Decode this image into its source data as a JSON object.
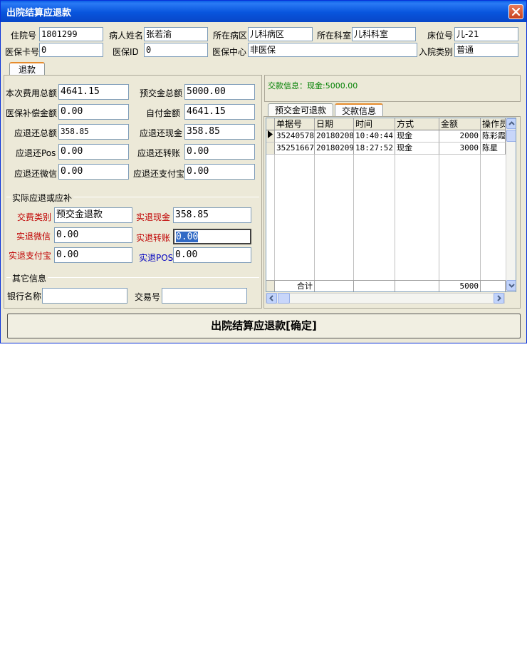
{
  "window": {
    "title": "出院结算应退款"
  },
  "patient": {
    "inpatient_no_label": "住院号",
    "inpatient_no": "1801299",
    "name_label": "病人姓名",
    "name": "张若渝",
    "ward_label": "所在病区",
    "ward": "儿科病区",
    "dept_label": "所在科室",
    "dept": "儿科科室",
    "bed_label": "床位号",
    "bed": "儿-21",
    "insurance_card_label": "医保卡号",
    "insurance_card": "0",
    "insurance_id_label": "医保ID",
    "insurance_id": "0",
    "insurance_center_label": "医保中心",
    "insurance_center": "非医保",
    "admission_type_label": "入院类别",
    "admission_type": "普通"
  },
  "left_tab": "退款",
  "summary": {
    "total_fee_label": "本次费用总额",
    "total_fee": "4641.15",
    "prepay_total_label": "预交金总额",
    "prepay_total": "5000.00",
    "insurance_comp_label": "医保补偿金额",
    "insurance_comp": "0.00",
    "self_pay_label": "自付金额",
    "self_pay": "4641.15",
    "refund_total_label": "应退还总额",
    "refund_total": "358.85",
    "refund_cash_label": "应退还现金",
    "refund_cash": "358.85",
    "refund_pos_label": "应退还Pos",
    "refund_pos": "0.00",
    "refund_transfer_label": "应退还转账",
    "refund_transfer": "0.00",
    "refund_wechat_label": "应退还微信",
    "refund_wechat": "0.00",
    "refund_alipay_label": "应退还支付宝",
    "refund_alipay": "0.00"
  },
  "actual": {
    "group_label": "实际应退或应补",
    "fee_type_label": "交费类别",
    "fee_type": "预交金退款",
    "cash_label": "实退现金",
    "cash": "358.85",
    "wechat_label": "实退微信",
    "wechat": "0.00",
    "transfer_label": "实退转账",
    "transfer": "0.00",
    "alipay_label": "实退支付宝",
    "alipay": "0.00",
    "pos_label": "实退POS",
    "pos": "0.00"
  },
  "other": {
    "group_label": "其它信息",
    "bank_label": "银行名称",
    "bank": "",
    "txn_label": "交易号",
    "txn": ""
  },
  "payment_info": {
    "text": "交款信息：现金:5000.00"
  },
  "right_tabs": [
    "预交金可退款",
    "交款信息"
  ],
  "table": {
    "columns": [
      "单据号",
      "日期",
      "时间",
      "方式",
      "金额",
      "操作员"
    ],
    "rows": [
      [
        "35240578",
        "20180208",
        "10:40:44",
        "现金",
        "2000",
        "陈彩霞"
      ],
      [
        "35251667",
        "20180209",
        "18:27:52",
        "现金",
        "3000",
        "陈星"
      ]
    ],
    "total_label": "合计",
    "total_amount": "5000"
  },
  "confirm_button": "出院结算应退款[确定]",
  "colors": {
    "title_bar": "#0855dd",
    "window_bg": "#ece9d8",
    "selection": "#316ac5"
  }
}
